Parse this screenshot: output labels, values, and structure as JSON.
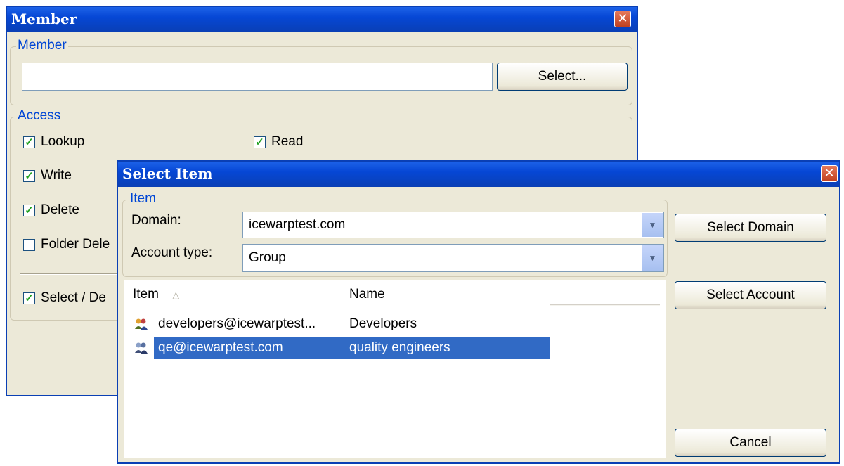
{
  "member_window": {
    "title": "Member",
    "close_glyph": "✕",
    "member_group": {
      "label": "Member",
      "input_value": "",
      "select_button": "Select..."
    },
    "access_group": {
      "label": "Access",
      "checkboxes": [
        {
          "label": "Lookup",
          "checked": true
        },
        {
          "label": "Read",
          "checked": true
        },
        {
          "label": "Write",
          "checked": true
        },
        {
          "label": "Delete",
          "checked": true
        },
        {
          "label": "Folder Dele",
          "checked": false
        },
        {
          "label": "Select / De",
          "checked": true
        }
      ]
    }
  },
  "select_item_window": {
    "title": "Select Item",
    "close_glyph": "✕",
    "item_group": {
      "label": "Item",
      "domain_label": "Domain:",
      "domain_value": "icewarptest.com",
      "account_type_label": "Account type:",
      "account_type_value": "Group"
    },
    "list": {
      "columns": [
        "Item",
        "Name"
      ],
      "sort_indicator": "△",
      "rows": [
        {
          "item": "developers@icewarptest...",
          "name": "Developers",
          "selected": false
        },
        {
          "item": "qe@icewarptest.com",
          "name": "quality engineers",
          "selected": true
        }
      ]
    },
    "buttons": {
      "select_domain": "Select Domain",
      "select_account": "Select Account",
      "cancel": "Cancel"
    }
  },
  "icons": {
    "close": "close-icon",
    "dropdown": "chevron-down-icon",
    "check": "checkmark-icon",
    "group": "group-icon"
  },
  "colors": {
    "titlebar": "#0a3fb4",
    "window_bg": "#ece9d8",
    "selection": "#316ac5",
    "group_label": "#0046d5"
  }
}
